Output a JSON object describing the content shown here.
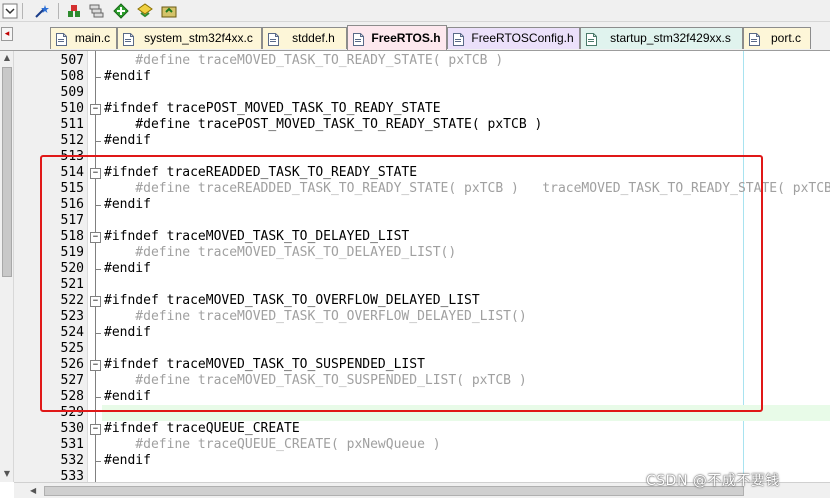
{
  "toolbar": {
    "buttons": [
      "dropdown-icon",
      "wand-icon",
      "build-target-icon",
      "batch-build-icon",
      "translate-icon",
      "rebuild-icon",
      "load-icon"
    ]
  },
  "tabs": [
    {
      "label": "main.c",
      "icon": "c-file-icon",
      "color": "#fdf6d8",
      "active": false
    },
    {
      "label": "system_stm32f4xx.c",
      "icon": "c-file-icon",
      "color": "#fdf6d8",
      "active": false
    },
    {
      "label": "stddef.h",
      "icon": "h-file-icon",
      "color": "#fdf6d8",
      "active": false
    },
    {
      "label": "FreeRTOS.h",
      "icon": "h-file-icon",
      "color": "#fde8ee",
      "active": true
    },
    {
      "label": "FreeRTOSConfig.h",
      "icon": "h-file-icon",
      "color": "#ebe0fa",
      "active": false
    },
    {
      "label": "startup_stm32f429xx.s",
      "icon": "asm-file-icon",
      "color": "#e0f3ee",
      "active": false
    },
    {
      "label": "port.c",
      "icon": "c-file-icon",
      "color": "#fdf6d8",
      "active": false
    }
  ],
  "code_lines": [
    {
      "num": "507",
      "text": "    #define traceMOVED_TASK_TO_READY_STATE( pxTCB )",
      "inactive": true,
      "fold": "none"
    },
    {
      "num": "508",
      "text": "#endif",
      "inactive": false,
      "fold": "end"
    },
    {
      "num": "509",
      "text": "",
      "inactive": false,
      "fold": "line"
    },
    {
      "num": "510",
      "text": "#ifndef tracePOST_MOVED_TASK_TO_READY_STATE",
      "inactive": false,
      "fold": "start"
    },
    {
      "num": "511",
      "text": "    #define tracePOST_MOVED_TASK_TO_READY_STATE( pxTCB )",
      "inactive": false,
      "fold": "line"
    },
    {
      "num": "512",
      "text": "#endif",
      "inactive": false,
      "fold": "end"
    },
    {
      "num": "513",
      "text": "",
      "inactive": false,
      "fold": "line"
    },
    {
      "num": "514",
      "text": "#ifndef traceREADDED_TASK_TO_READY_STATE",
      "inactive": false,
      "fold": "start"
    },
    {
      "num": "515",
      "text": "    #define traceREADDED_TASK_TO_READY_STATE( pxTCB )   traceMOVED_TASK_TO_READY_STATE( pxTCB )",
      "inactive": true,
      "fold": "line"
    },
    {
      "num": "516",
      "text": "#endif",
      "inactive": false,
      "fold": "end"
    },
    {
      "num": "517",
      "text": "",
      "inactive": false,
      "fold": "line"
    },
    {
      "num": "518",
      "text": "#ifndef traceMOVED_TASK_TO_DELAYED_LIST",
      "inactive": false,
      "fold": "start"
    },
    {
      "num": "519",
      "text": "    #define traceMOVED_TASK_TO_DELAYED_LIST()",
      "inactive": true,
      "fold": "line"
    },
    {
      "num": "520",
      "text": "#endif",
      "inactive": false,
      "fold": "end"
    },
    {
      "num": "521",
      "text": "",
      "inactive": false,
      "fold": "line"
    },
    {
      "num": "522",
      "text": "#ifndef traceMOVED_TASK_TO_OVERFLOW_DELAYED_LIST",
      "inactive": false,
      "fold": "start"
    },
    {
      "num": "523",
      "text": "    #define traceMOVED_TASK_TO_OVERFLOW_DELAYED_LIST()",
      "inactive": true,
      "fold": "line"
    },
    {
      "num": "524",
      "text": "#endif",
      "inactive": false,
      "fold": "end"
    },
    {
      "num": "525",
      "text": "",
      "inactive": false,
      "fold": "line"
    },
    {
      "num": "526",
      "text": "#ifndef traceMOVED_TASK_TO_SUSPENDED_LIST",
      "inactive": false,
      "fold": "start"
    },
    {
      "num": "527",
      "text": "    #define traceMOVED_TASK_TO_SUSPENDED_LIST( pxTCB )",
      "inactive": true,
      "fold": "line"
    },
    {
      "num": "528",
      "text": "#endif",
      "inactive": false,
      "fold": "end"
    },
    {
      "num": "529",
      "text": "",
      "inactive": false,
      "fold": "line",
      "current": true
    },
    {
      "num": "530",
      "text": "#ifndef traceQUEUE_CREATE",
      "inactive": false,
      "fold": "start"
    },
    {
      "num": "531",
      "text": "    #define traceQUEUE_CREATE( pxNewQueue )",
      "inactive": true,
      "fold": "line"
    },
    {
      "num": "532",
      "text": "#endif",
      "inactive": false,
      "fold": "end"
    },
    {
      "num": "533",
      "text": "",
      "inactive": false,
      "fold": "line"
    }
  ],
  "highlight": {
    "color": "#e01818"
  },
  "watermark": "CSDN @不成不要钱"
}
